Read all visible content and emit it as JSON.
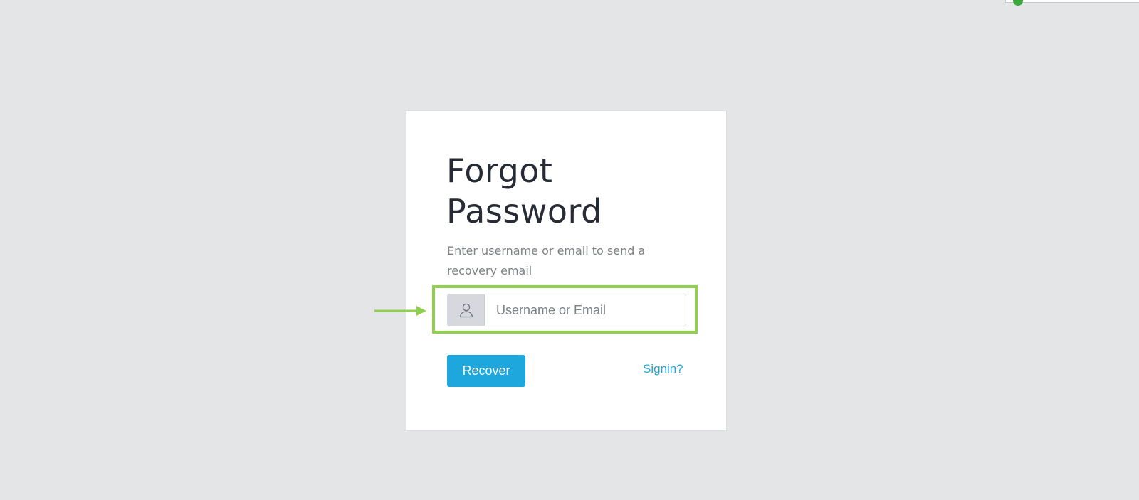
{
  "form": {
    "title_line1": "Forgot",
    "title_line2": "Password",
    "subtitle": "Enter username or email to send a recovery email",
    "username_field": {
      "placeholder": "Username or Email",
      "value": "",
      "icon": "user-icon"
    },
    "recover_label": "Recover",
    "signin_label": "Signin?"
  },
  "annotation": {
    "highlight_color": "#8fd14f",
    "arrow_color": "#8fd14f"
  },
  "colors": {
    "background": "#e4e5e7",
    "accent": "#1ea7dd",
    "title": "#272b35",
    "subtitle": "#7d8087"
  }
}
